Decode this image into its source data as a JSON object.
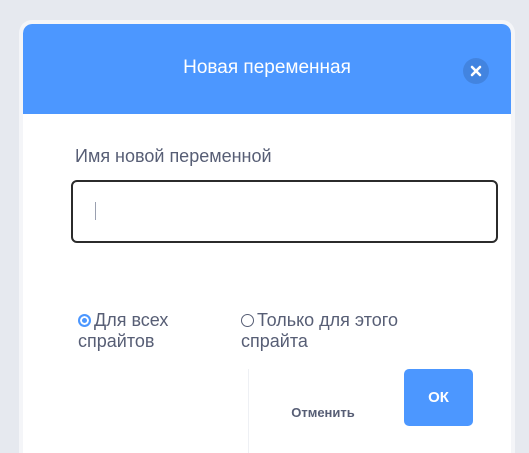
{
  "dialog": {
    "title": "Новая переменная",
    "close_icon": "close-icon"
  },
  "form": {
    "name_label": "Имя новой переменной",
    "name_value": "",
    "name_placeholder": ""
  },
  "scope": {
    "all_sprites_line1": "Для всех",
    "all_sprites_line2": "спрайтов",
    "all_sprites_checked": true,
    "this_sprite_line1": "Только для этого",
    "this_sprite_line2": "спрайта",
    "this_sprite_checked": false
  },
  "actions": {
    "cancel_label": "Отменить",
    "ok_label": "ОК"
  },
  "colors": {
    "accent": "#4c97ff",
    "text": "#575e75"
  }
}
